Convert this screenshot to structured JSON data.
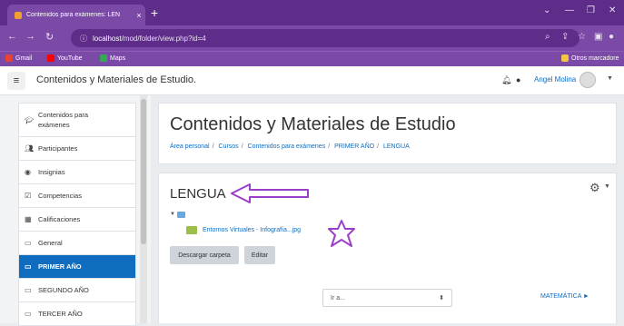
{
  "browser": {
    "tab_title": "Contenidos para exámenes: LEN",
    "tab_close": "×",
    "new_tab": "+",
    "url_host": "localhost",
    "url_path": "/mod/folder/view.php?id=4",
    "bookmarks": [
      {
        "label": "Gmail",
        "color": "#ea4335"
      },
      {
        "label": "YouTube",
        "color": "#ff0000"
      },
      {
        "label": "Maps",
        "color": "#34a853"
      }
    ],
    "other_bookmarks": "Otros marcadore"
  },
  "navbar": {
    "site_name": "Contenidos y Materiales de Estudio.",
    "user_name": "Angel Molina"
  },
  "sidebar": {
    "items": [
      {
        "label": "Contenidos para exámenes",
        "icon": "mortarboard-icon"
      },
      {
        "label": "Participantes",
        "icon": "users-icon"
      },
      {
        "label": "Insignias",
        "icon": "badge-icon"
      },
      {
        "label": "Competencias",
        "icon": "check-square-icon"
      },
      {
        "label": "Calificaciones",
        "icon": "table-icon"
      },
      {
        "label": "General",
        "icon": "folder-icon"
      },
      {
        "label": "PRIMER AÑO",
        "icon": "folder-icon"
      },
      {
        "label": "SEGUNDO AÑO",
        "icon": "folder-icon"
      },
      {
        "label": "TERCER AÑO",
        "icon": "folder-icon"
      }
    ]
  },
  "header": {
    "title": "Contenidos y Materiales de Estudio",
    "breadcrumb": [
      "Área personal",
      "Cursos",
      "Contenidos para exámenes",
      "PRIMER AÑO",
      "LENGUA"
    ]
  },
  "content": {
    "section_title": "LENGUA",
    "file_name": "Entornos Virtuales - Infografía...jpg",
    "download_button": "Descargar carpeta",
    "edit_button": "Editar",
    "jump_select": "Ir a...",
    "next_link": "MATEMÁTICA ►"
  },
  "colors": {
    "browser_dark": "#5e2d8a",
    "browser_light": "#7a4aa6",
    "link": "#0f6cbf",
    "active_item": "#0f6cbf",
    "annotation": "#9b3fc8"
  }
}
